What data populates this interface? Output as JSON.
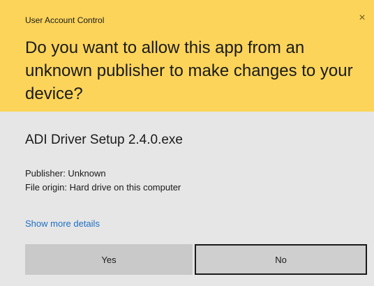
{
  "dialog": {
    "title": "User Account Control",
    "close_symbol": "×",
    "question": "Do you want to allow this app from an unknown publisher to make changes to your device?",
    "app_name": "ADI Driver Setup 2.4.0.exe",
    "publisher": "Publisher: Unknown",
    "file_origin": "File origin: Hard drive on this computer",
    "details_link": "Show more details",
    "yes_label": "Yes",
    "no_label": "No"
  },
  "colors": {
    "header_background": "#fcd45a",
    "body_background": "#e6e6e6",
    "link": "#1e6fc4",
    "button": "#c9c9c9",
    "focus_border": "#1a1a1a"
  },
  "icons": {
    "close": "close-icon"
  }
}
